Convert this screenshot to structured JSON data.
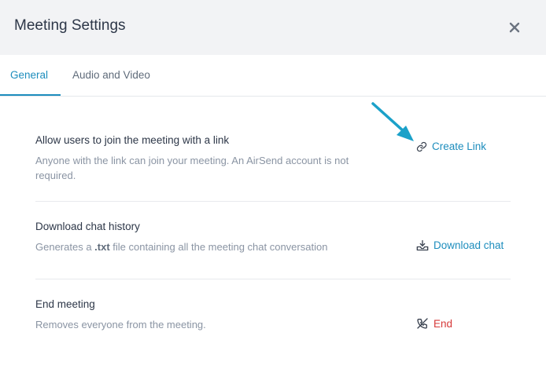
{
  "dialog": {
    "title": "Meeting Settings"
  },
  "tabs": [
    {
      "label": "General",
      "active": true
    },
    {
      "label": "Audio and Video",
      "active": false
    }
  ],
  "settings": {
    "link": {
      "title": "Allow users to join the meeting with a link",
      "description": "Anyone with the link can join your meeting. An AirSend account is not required.",
      "action": "Create Link",
      "icon": "link-icon"
    },
    "download": {
      "title": "Download chat history",
      "description_prefix": "Generates a ",
      "description_ext": ".txt",
      "description_suffix": " file containing all the meeting chat conversation",
      "action": "Download chat",
      "icon": "download-icon"
    },
    "end": {
      "title": "End meeting",
      "description": "Removes everyone from the meeting.",
      "action": "End",
      "icon": "phone-off-icon"
    }
  },
  "colors": {
    "accent": "#1d8dbd",
    "danger": "#d63939",
    "header_bg": "#f2f3f5",
    "arrow": "#1ba1c9"
  }
}
